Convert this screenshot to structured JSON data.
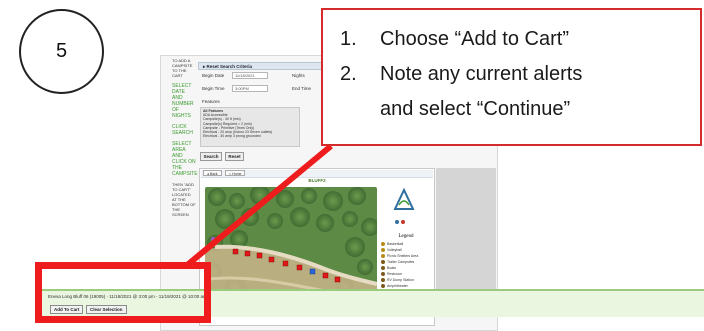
{
  "step_number": "5",
  "callout": {
    "item1_number": "1.",
    "item1_text": "Choose “Add to Cart”",
    "item2_number": "2.",
    "item2_line1": "Note any current alerts",
    "item2_line2": "and select “Continue”"
  },
  "sidebar": {
    "text1": "TO ADD A CAMPSITE TO THE CART",
    "text2": "SELECT DATE AND NUMBER OF NIGHTS",
    "text3": "CLICK SEARCH",
    "text4": "SELECT AREA AND CLICK ON THE CAMPSITE",
    "text5": "THEN \"ADD TO CART\" Located at the bottom of the screen"
  },
  "search_criteria": {
    "header": "Reset Search Criteria",
    "begin_date_label": "Begin Date",
    "begin_date_value": "11/18/2021",
    "nights_label": "Nights",
    "begin_time_label": "Begin Time",
    "begin_time_value": "3:00PM",
    "end_time_label": "End Time",
    "features_label": "Features",
    "features": [
      "All Features",
      "ADA Accessible",
      "Campsite(s) - 40 ft (min)",
      "Campsite(s) Required = 2 (min)",
      "Campsite - Primitive (Tents Only)",
      "Electrical - 20 amp (Indoor 23 Seven outlets)",
      "Electrical - 30 amp 3 prong grounded"
    ],
    "search_button": "Search",
    "reset_button": "Reset"
  },
  "map": {
    "back_button": "Back",
    "home_button": "Home",
    "title": "BLUFF2",
    "legend_title": "Legend",
    "legend_items": [
      "Basketball",
      "Volleyball",
      "Picnic Shelters Area",
      "Trailer Campsites",
      "Boats",
      "Restroom",
      "RV Dump Station",
      "Amphitheater",
      "Playground",
      "Parking"
    ]
  },
  "selection": {
    "summary": "Eneva Long Bluff 06 (19005) · 11/18/2021 @ 3:00 pm - 11/19/2021 @ 10:00 am",
    "add_to_cart_button": "Add To Cart",
    "clear_selection_button": "Clear Selection"
  },
  "colors": {
    "highlight_red": "#ee1c1c",
    "callout_border": "#d62b2b",
    "sidebar_green": "#3a9b2e",
    "bottom_bar_green": "#eaf6e0"
  }
}
